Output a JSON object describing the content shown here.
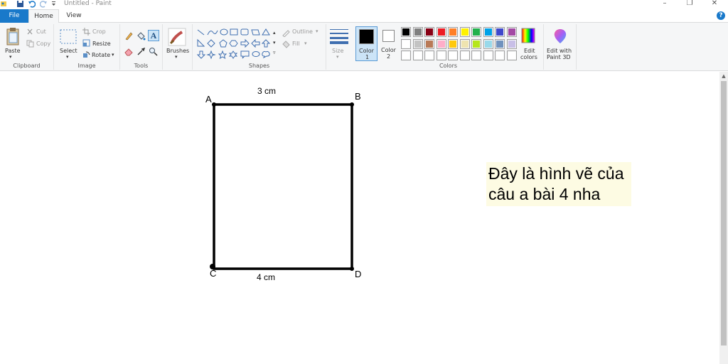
{
  "window": {
    "title": "Untitled - Paint"
  },
  "tabs": {
    "file": "File",
    "home": "Home",
    "view": "View"
  },
  "clipboard": {
    "paste": "Paste",
    "cut": "Cut",
    "copy": "Copy",
    "group": "Clipboard"
  },
  "image": {
    "select": "Select",
    "crop": "Crop",
    "resize": "Resize",
    "rotate": "Rotate",
    "group": "Image"
  },
  "tools": {
    "group": "Tools"
  },
  "brushes": {
    "label": "Brushes"
  },
  "shapes": {
    "outline": "Outline",
    "fill": "Fill",
    "group": "Shapes"
  },
  "size": {
    "label": "Size"
  },
  "colors": {
    "color1_label": "Color",
    "color1_num": "1",
    "color2_label": "Color",
    "color2_num": "2",
    "color1_value": "#000000",
    "color2_value": "#ffffff",
    "edit_colors_line1": "Edit",
    "edit_colors_line2": "colors",
    "group": "Colors",
    "palette_row1": [
      "#000000",
      "#7f7f7f",
      "#880015",
      "#ed1c24",
      "#ff7f27",
      "#fff200",
      "#22b14c",
      "#00a2e8",
      "#3f48cc",
      "#a349a4"
    ],
    "palette_row2": [
      "#ffffff",
      "#c3c3c3",
      "#b97a57",
      "#ffaec9",
      "#ffc90e",
      "#efe4b0",
      "#b5e61d",
      "#99d9ea",
      "#7092be",
      "#c8bfe7"
    ],
    "palette_row3": [
      "#ffffff",
      "#ffffff",
      "#ffffff",
      "#ffffff",
      "#ffffff",
      "#ffffff",
      "#ffffff",
      "#ffffff",
      "#ffffff",
      "#ffffff"
    ]
  },
  "paint3d": {
    "line1": "Edit with",
    "line2": "Paint 3D"
  },
  "drawing": {
    "vertex_a": "A",
    "vertex_b": "B",
    "vertex_c": "C",
    "vertex_d": "D",
    "top_side": "3 cm",
    "bottom_side": "4 cm",
    "note_line1": "Đây là hình vẽ của",
    "note_line2": "câu a bài 4 nha"
  }
}
